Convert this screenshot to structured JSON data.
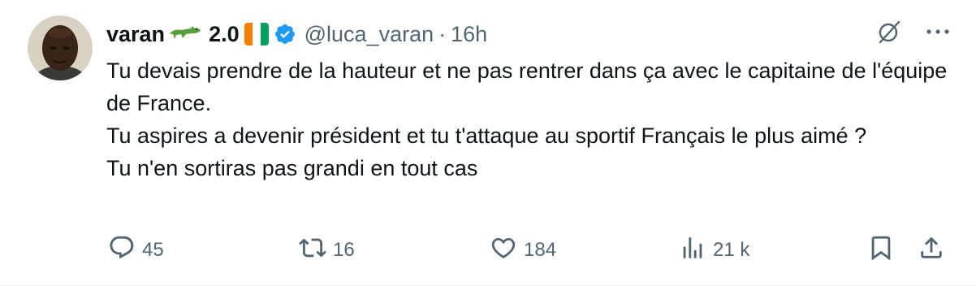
{
  "tweet": {
    "author": {
      "display_name": "varan",
      "name_emoji": "crocodile-emoji",
      "name_suffix": "2.0",
      "flag": "cote-divoire-flag",
      "verified": true,
      "handle": "@luca_varan",
      "separator": "·",
      "time": "16h"
    },
    "body_lines": [
      "Tu devais prendre de la hauteur et ne pas rentrer dans ça avec le capitaine de l'équipe de France.",
      "Tu aspires a devenir président et tu t'attaque au sportif Français le plus aimé ?",
      "Tu n'en sortiras pas grandi en tout cas"
    ],
    "actions": {
      "replies": "45",
      "reposts": "16",
      "likes": "184",
      "views": "21 k"
    }
  },
  "colors": {
    "text": "#0f1419",
    "muted": "#536471",
    "verified_blue": "#1d9bf0",
    "flag_orange": "#f77f00",
    "flag_white": "#ffffff",
    "flag_green": "#009e60",
    "croc_green": "#5a9e3a"
  }
}
